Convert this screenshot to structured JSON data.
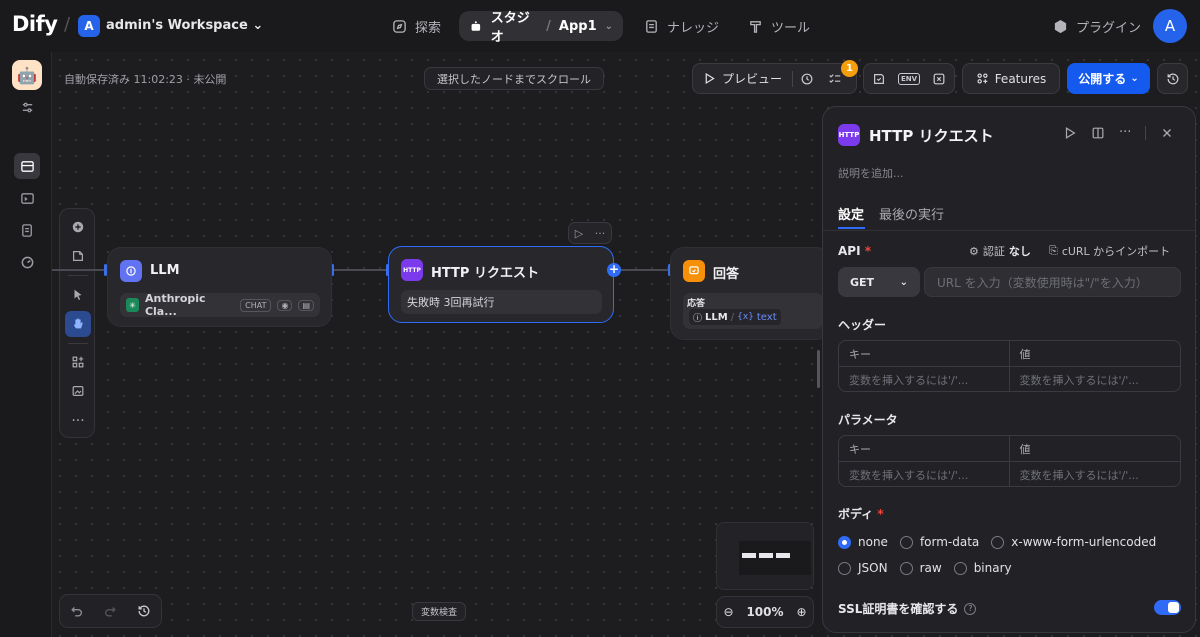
{
  "topbar": {
    "logo": "Dify",
    "workspace_initial": "A",
    "workspace_name": "admin's Workspace",
    "nav": {
      "explore": "探索",
      "studio": "スタジオ",
      "app_name": "App1",
      "knowledge": "ナレッジ",
      "tools": "ツール",
      "plugins": "プラグイン"
    },
    "user_initial": "A"
  },
  "toolbar": {
    "autosave": "自動保存済み 11:02:23 · 未公開",
    "scroll_to_selected": "選択したノードまでスクロール",
    "preview": "プレビュー",
    "checklist_badge": "1",
    "env_label": "ENV",
    "features": "Features",
    "publish": "公開する"
  },
  "nodes": {
    "llm": {
      "title": "LLM",
      "model": "Anthropic Cla...",
      "mode_tag": "CHAT"
    },
    "http": {
      "title": "HTTP リクエスト",
      "icon_text": "HTTP",
      "retry": "失敗時 3回再試行"
    },
    "answer": {
      "title": "回答",
      "label": "応答",
      "var_source": "LLM",
      "var_name": "text"
    }
  },
  "bottom": {
    "variable_inspect": "変数検査",
    "zoom": "100%"
  },
  "panel": {
    "icon_text": "HTTP",
    "title": "HTTP リクエスト",
    "description_placeholder": "説明を追加...",
    "tabs": [
      "設定",
      "最後の実行"
    ],
    "api_label": "API",
    "auth_label": "認証",
    "auth_value": "なし",
    "curl_import": "cURL からインポート",
    "method": "GET",
    "url_placeholder": "URL を入力（変数使用時は\"/\"を入力）",
    "headers": {
      "label": "ヘッダー",
      "key_header": "キー",
      "value_header": "値",
      "key_placeholder": "変数を挿入するには'/'...",
      "value_placeholder": "変数を挿入するには'/'..."
    },
    "params": {
      "label": "パラメータ",
      "key_header": "キー",
      "value_header": "値",
      "key_placeholder": "変数を挿入するには'/'...",
      "value_placeholder": "変数を挿入するには'/'..."
    },
    "body": {
      "label": "ボディ",
      "options": [
        "none",
        "form-data",
        "x-www-form-urlencoded",
        "JSON",
        "raw",
        "binary"
      ],
      "selected": "none"
    },
    "ssl_label": "SSL証明書を確認する",
    "ssl_enabled": true
  },
  "colors": {
    "accent": "#155aef",
    "badge": "#f59e0b",
    "http_icon": "#7c3aed",
    "llm_icon": "#6172f3",
    "answer_icon": "#f79009"
  }
}
